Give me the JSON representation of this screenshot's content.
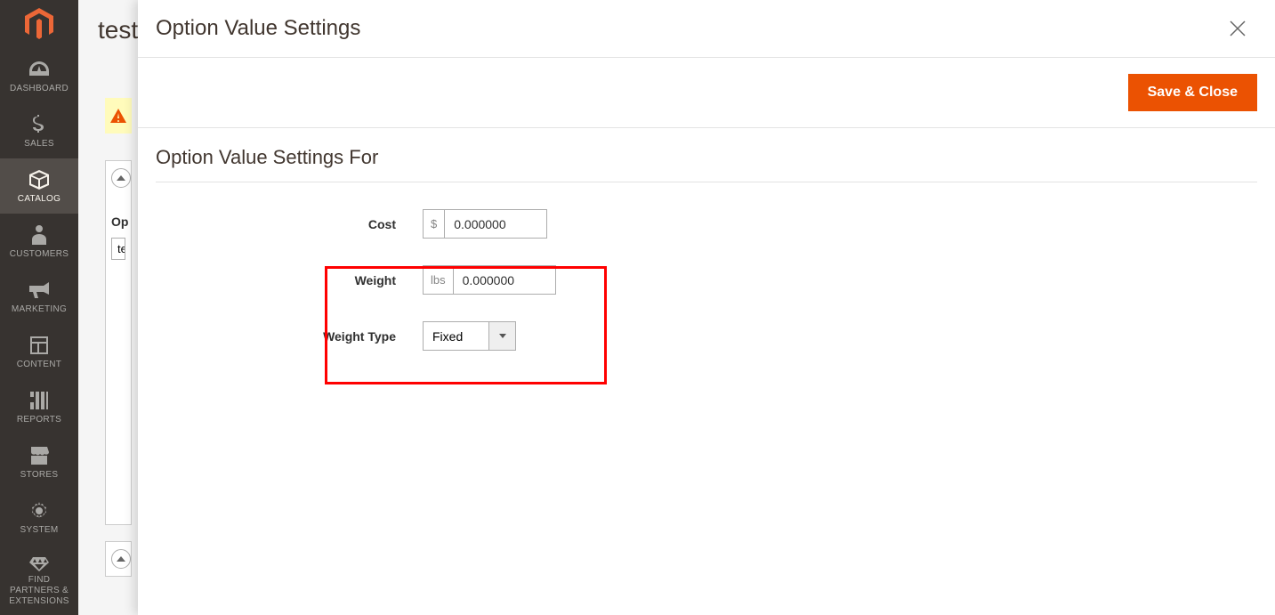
{
  "sidebar": {
    "items": [
      {
        "label": "DASHBOARD"
      },
      {
        "label": "SALES"
      },
      {
        "label": "CATALOG"
      },
      {
        "label": "CUSTOMERS"
      },
      {
        "label": "MARKETING"
      },
      {
        "label": "CONTENT"
      },
      {
        "label": "REPORTS"
      },
      {
        "label": "STORES"
      },
      {
        "label": "SYSTEM"
      },
      {
        "label": "FIND PARTNERS & EXTENSIONS"
      }
    ]
  },
  "page": {
    "title_partial": "test",
    "bg_option_label": "Op",
    "bg_input_partial": "te"
  },
  "modal": {
    "title": "Option Value Settings",
    "save_label": "Save & Close",
    "section_title": "Option Value Settings For",
    "fields": {
      "cost": {
        "label": "Cost",
        "prefix": "$",
        "value": "0.000000"
      },
      "weight": {
        "label": "Weight",
        "prefix": "lbs",
        "value": "0.000000"
      },
      "weight_type": {
        "label": "Weight Type",
        "value": "Fixed"
      }
    }
  }
}
